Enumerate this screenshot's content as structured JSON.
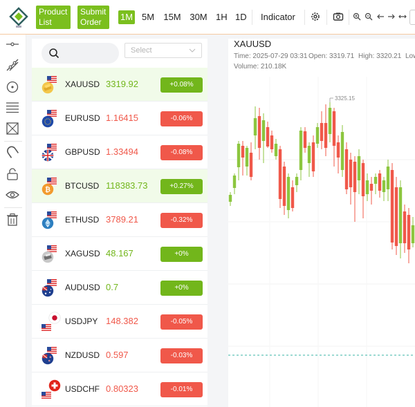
{
  "toolbar": {
    "product_list_label": "Product List",
    "submit_order_label": "Submit Order",
    "timeframes": [
      "1M",
      "5M",
      "15M",
      "30M",
      "1H",
      "1D"
    ],
    "active_timeframe": "1M",
    "indicator_label": "Indicator"
  },
  "search": {
    "select_placeholder": "Select"
  },
  "products": [
    {
      "symbol": "XAUUSD",
      "price": "3319.92",
      "change": "+0.08%",
      "direction": "up",
      "highlight": true,
      "icon": "gold-bar-icon"
    },
    {
      "symbol": "EURUSD",
      "price": "1.16415",
      "change": "-0.06%",
      "direction": "down",
      "highlight": false,
      "icon": "eu-flag-icon"
    },
    {
      "symbol": "GBPUSD",
      "price": "1.33494",
      "change": "-0.08%",
      "direction": "down",
      "highlight": false,
      "icon": "uk-flag-icon"
    },
    {
      "symbol": "BTCUSD",
      "price": "118383.73",
      "change": "+0.27%",
      "direction": "up",
      "highlight": true,
      "icon": "bitcoin-icon"
    },
    {
      "symbol": "ETHUSD",
      "price": "3789.21",
      "change": "-0.32%",
      "direction": "down",
      "highlight": false,
      "icon": "ethereum-icon"
    },
    {
      "symbol": "XAGUSD",
      "price": "48.167",
      "change": "+0%",
      "direction": "up",
      "highlight": false,
      "icon": "silver-bar-icon"
    },
    {
      "symbol": "AUDUSD",
      "price": "0.7",
      "change": "+0%",
      "direction": "up",
      "highlight": false,
      "icon": "au-flag-icon"
    },
    {
      "symbol": "USDJPY",
      "price": "148.382",
      "change": "-0.05%",
      "direction": "down",
      "highlight": false,
      "icon": "jp-flag-icon"
    },
    {
      "symbol": "NZDUSD",
      "price": "0.597",
      "change": "-0.03%",
      "direction": "down",
      "highlight": false,
      "icon": "nz-flag-icon"
    },
    {
      "symbol": "USDCHF",
      "price": "0.80323",
      "change": "-0.01%",
      "direction": "down",
      "highlight": false,
      "icon": "ch-flag-icon"
    }
  ],
  "chart": {
    "symbol": "XAUUSD",
    "time_label": "Time:",
    "time_value": "2025-07-29 03:31",
    "open_label": "Open:",
    "open_value": "3319.71",
    "high_label": "High:",
    "high_value": "3320.21",
    "low_label": "Low",
    "volume_label": "Volume:",
    "volume_value": "210.18K",
    "max_marker": "3325.15"
  },
  "colors": {
    "accent_green": "#7bbf1e",
    "up": "#72b61b",
    "down": "#f0584a"
  }
}
